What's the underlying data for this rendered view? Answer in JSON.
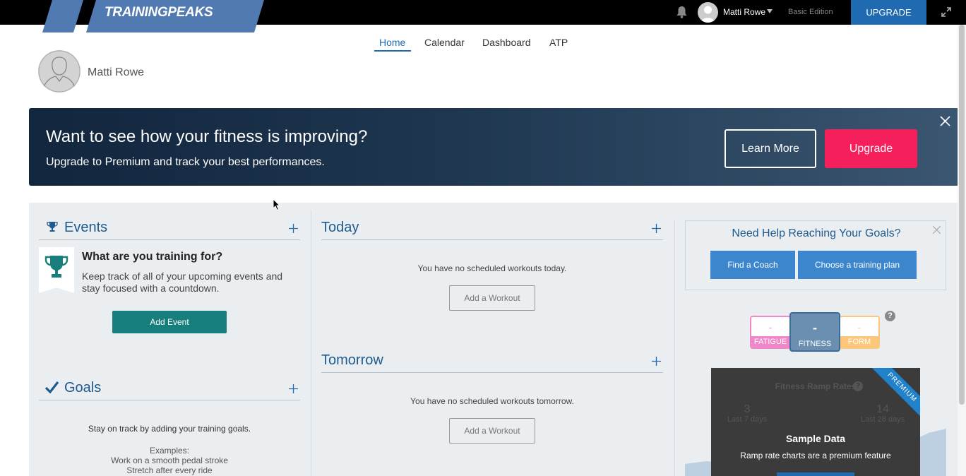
{
  "topbar": {
    "logo": "TRAININGPEAKS",
    "username": "Matti Rowe",
    "edition": "Basic Edition",
    "upgrade_label": "UPGRADE"
  },
  "nav": {
    "tabs": [
      "Home",
      "Calendar",
      "Dashboard",
      "ATP"
    ],
    "active": "Home"
  },
  "profile": {
    "name": "Matti Rowe"
  },
  "banner": {
    "title": "Want to see how your fitness is improving?",
    "subtitle": "Upgrade to Premium and track your best performances.",
    "learn_more": "Learn More",
    "upgrade": "Upgrade"
  },
  "events": {
    "title": "Events",
    "question": "What are you training for?",
    "description": "Keep track of all of your upcoming events and stay focused with a countdown.",
    "add_button": "Add Event"
  },
  "goals": {
    "title": "Goals",
    "text": "Stay on track by adding your training goals.",
    "examples_label": "Examples:",
    "examples": [
      "Work on a smooth pedal stroke",
      "Stretch after every ride"
    ]
  },
  "today": {
    "title": "Today",
    "empty": "You have no scheduled workouts today.",
    "add_button": "Add a Workout"
  },
  "tomorrow": {
    "title": "Tomorrow",
    "empty": "You have no scheduled workouts tomorrow.",
    "add_button": "Add a Workout"
  },
  "help": {
    "title": "Need Help Reaching Your Goals?",
    "find_coach": "Find a Coach",
    "choose_plan": "Choose a training plan"
  },
  "metrics": {
    "fatigue": {
      "value": "-",
      "label": "FATIGUE"
    },
    "fitness": {
      "value": "-",
      "label": "FITNESS"
    },
    "form": {
      "value": "-",
      "label": "FORM"
    },
    "help": "?"
  },
  "ramp": {
    "title": "Fitness Ramp Rates",
    "left_value": "3",
    "left_label": "Last 7 days",
    "right_value": "14",
    "right_label": "Last 28 days",
    "premium": "PREMIUM",
    "sample_title": "Sample Data",
    "sample_desc": "Ramp rate charts are a premium feature"
  },
  "colors": {
    "brand_blue": "#1f6ab0",
    "upgrade_pink": "#f51f5b",
    "event_teal": "#167f7b",
    "fatigue_pink": "#ef87c9",
    "form_orange": "#fcc77a"
  }
}
